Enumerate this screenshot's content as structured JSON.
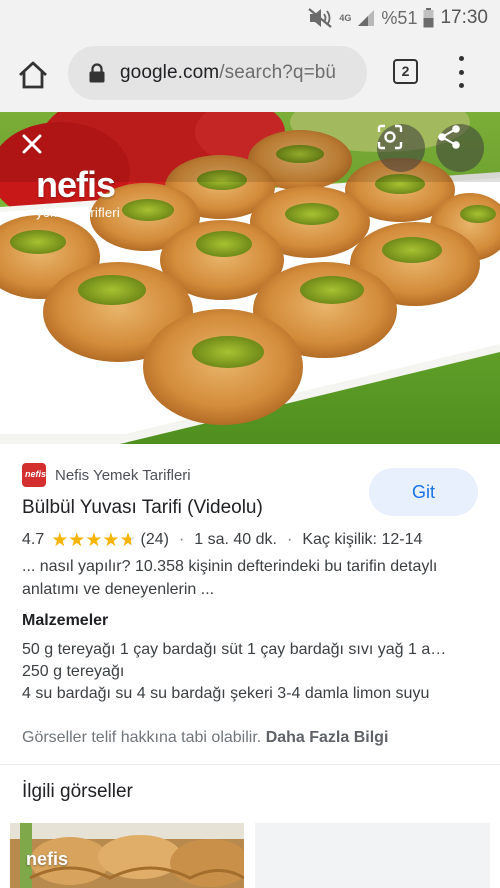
{
  "status_bar": {
    "battery": "%51",
    "time": "17:30",
    "network": "4G"
  },
  "browser": {
    "url_domain": "google.com",
    "url_path": "/search?q=bü",
    "tab_count": "2"
  },
  "image": {
    "watermark_name": "nefis",
    "watermark_sub": "yemek tarifleri"
  },
  "result": {
    "source": "Nefis Yemek Tarifleri",
    "favicon_text": "nefis",
    "visit_label": "Git",
    "title": "Bülbül Yuvası Tarifi (Videolu)",
    "rating": "4.7",
    "stars": 4.7,
    "review_count": "(24)",
    "duration": "1 sa. 40 dk.",
    "servings": "Kaç kişilik: 12-14",
    "snippet": "... nasıl yapılır? 10.358 kişinin defterindeki bu tarifin detaylı anlatımı ve deneyenlerin ...",
    "ingredients_heading": "Malzemeler",
    "ingredients": [
      "50 g tereyağı 1 çay bardağı süt 1 çay bardağı sıvı yağ 1 a…",
      "250 g tereyağı",
      "4 su bardağı su 4 su bardağı şekeri 3-4 damla limon suyu"
    ],
    "copyright_text": "Görseller telif hakkına tabi olabilir.",
    "more_info_label": "Daha Fazla Bilgi"
  },
  "related": {
    "title": "İlgili görseller",
    "thumb1_watermark": "nefis"
  },
  "colors": {
    "accent_blue": "#1a73e8",
    "visit_bg": "#e8f0fe",
    "star": "#f4b400",
    "brand_red": "#d32f2f"
  },
  "icons": [
    "mute-icon",
    "signal-icon",
    "battery-icon",
    "home-icon",
    "lock-icon",
    "tabs-icon",
    "more-menu-icon",
    "close-icon",
    "lens-icon",
    "share-icon",
    "star-icon"
  ]
}
